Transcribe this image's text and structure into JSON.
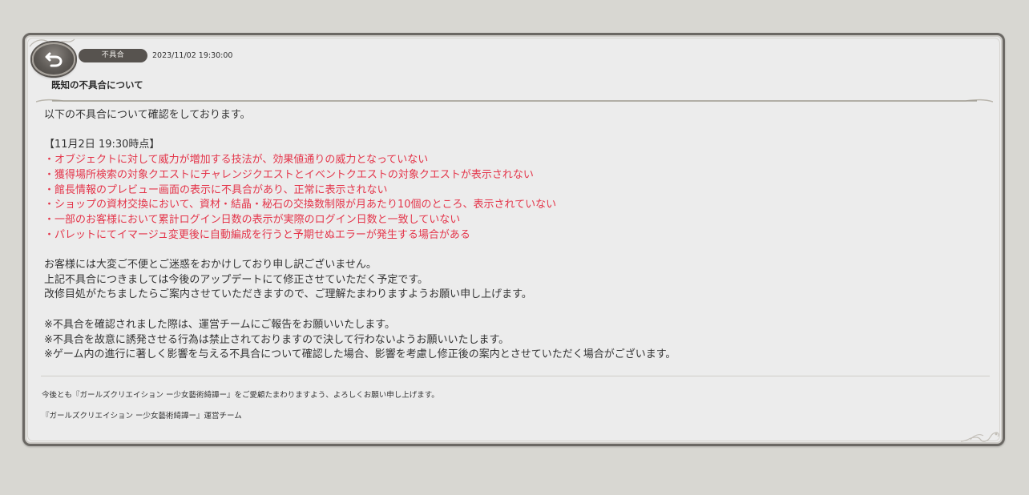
{
  "header": {
    "category": "不具合",
    "date": "2023/11/02 19:30:00",
    "title": "既知の不具合について"
  },
  "body": {
    "intro": "以下の不具合について確認をしております。",
    "issues_heading": "【11月2日 19:30時点】",
    "issues": [
      "・オブジェクトに対して威力が増加する技法が、効果値通りの威力となっていない",
      "・獲得場所検索の対象クエストにチャレンジクエストとイベントクエストの対象クエストが表示されない",
      "・館長情報のプレビュー画面の表示に不具合があり、正常に表示されない",
      "・ショップの資材交換において、資材・結晶・秘石の交換数制限が月あたり10個のところ、表示されていない",
      "・一部のお客様において累計ログイン日数の表示が実際のログイン日数と一致していない",
      "・パレットにてイマージュ変更後に自動編成を行うと予期せぬエラーが発生する場合がある"
    ],
    "apology": [
      "お客様には大変ご不便とご迷惑をおかけしており申し訳ございません。",
      "上記不具合につきましては今後のアップデートにて修正させていただく予定です。",
      "改修目処がたちましたらご案内させていただきますので、ご理解たまわりますようお願い申し上げます。"
    ],
    "notes": [
      "※不具合を確認されました際は、運営チームにご報告をお願いいたします。",
      "※不具合を故意に誘発させる行為は禁止されておりますので決して行わないようお願いいたします。",
      "※ゲーム内の進行に著しく影響を与える不具合について確認した場合、影響を考慮し修正後の案内とさせていただく場合がございます。"
    ]
  },
  "footer": {
    "closing": "今後とも『ガールズクリエイション ー少女藝術綺譚ー』をご愛顧たまわりますよう、よろしくお願い申し上げます。",
    "signature": "『ガールズクリエイション ー少女藝術綺譚ー』運営チーム"
  },
  "colors": {
    "issue_text": "#e4354a",
    "badge_bg": "#57534f",
    "panel_bg": "#ececec",
    "page_bg": "#d8d7d2"
  },
  "icons": {
    "back": "back-arrow-icon"
  }
}
